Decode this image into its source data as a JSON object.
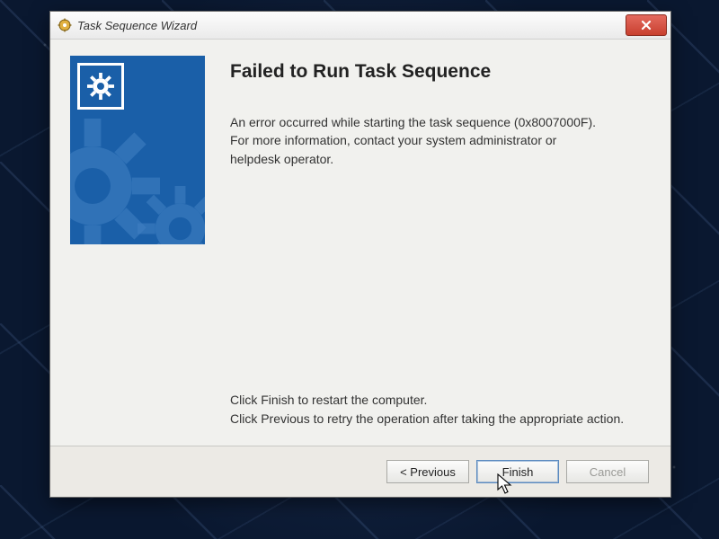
{
  "window": {
    "title": "Task Sequence Wizard"
  },
  "content": {
    "heading": "Failed to Run Task Sequence",
    "error_message": "An error occurred while starting the task sequence (0x8007000F). For more information, contact your system administrator or helpdesk operator.",
    "instruction_finish": "Click Finish to restart the computer.",
    "instruction_previous": "Click Previous to retry the operation after taking the appropriate action."
  },
  "buttons": {
    "previous": "< Previous",
    "finish": "Finish",
    "cancel": "Cancel"
  }
}
